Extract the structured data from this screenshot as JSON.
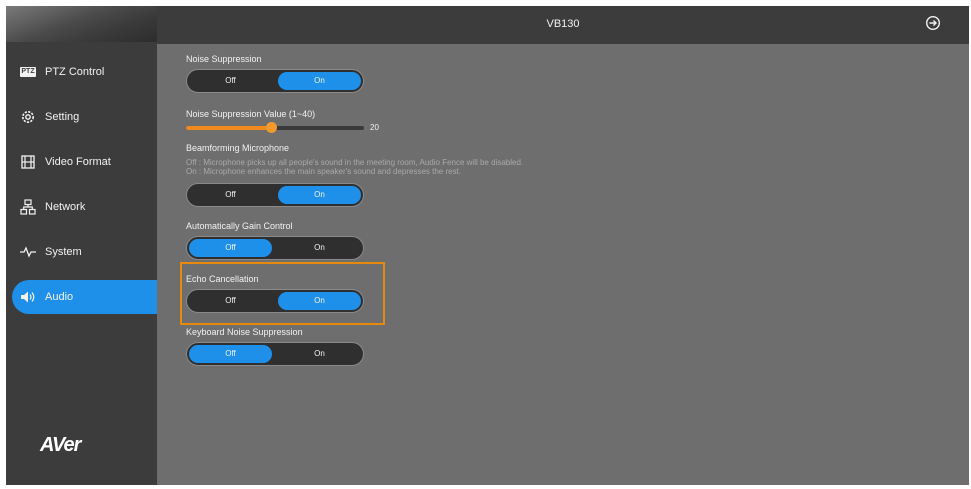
{
  "header": {
    "title": "VB130",
    "logout_icon": "logout-icon"
  },
  "sidebar": {
    "items": [
      {
        "label": "PTZ Control",
        "icon": "ptz-icon",
        "active": false
      },
      {
        "label": "Setting",
        "icon": "gear-icon",
        "active": false
      },
      {
        "label": "Video Format",
        "icon": "film-icon",
        "active": false
      },
      {
        "label": "Network",
        "icon": "network-icon",
        "active": false
      },
      {
        "label": "System",
        "icon": "pulse-icon",
        "active": false
      },
      {
        "label": "Audio",
        "icon": "speaker-icon",
        "active": true
      }
    ],
    "logo": "AVer",
    "ptz_badge": "PTZ"
  },
  "settings": {
    "noise_suppression": {
      "label": "Noise Suppression",
      "off": "Off",
      "on": "On",
      "selected": "On"
    },
    "noise_suppression_value": {
      "label": "Noise Suppression Value (1~40)",
      "value": "20",
      "min": 1,
      "max": 40
    },
    "beamforming": {
      "label": "Beamforming Microphone",
      "desc_off": "Off : Microphone picks up all people's sound in the meeting room, Audio Fence will be disabled.",
      "desc_on": "On : Microphone enhances the main speaker's sound and depresses the rest.",
      "off": "Off",
      "on": "On",
      "selected": "On"
    },
    "agc": {
      "label": "Automatically Gain Control",
      "off": "Off",
      "on": "On",
      "selected": "Off"
    },
    "echo_cancellation": {
      "label": "Echo Cancellation",
      "off": "Off",
      "on": "On",
      "selected": "On",
      "highlighted": true
    },
    "keyboard_noise": {
      "label": "Keyboard Noise Suppression",
      "off": "Off",
      "on": "On",
      "selected": "Off"
    }
  },
  "colors": {
    "accent": "#1e90ea",
    "slider": "#f08a1c",
    "highlight": "#e8890f",
    "panel": "#6e6e6e",
    "sidebar": "#3c3c3c"
  }
}
